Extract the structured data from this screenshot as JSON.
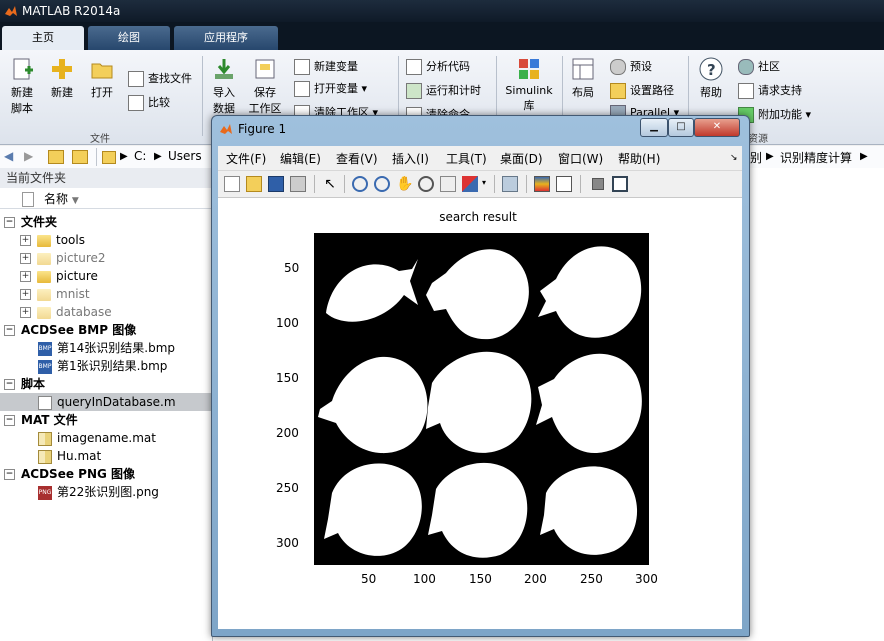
{
  "app": {
    "title": "MATLAB R2014a"
  },
  "ribbon_tabs": [
    {
      "label": "主页",
      "active": true
    },
    {
      "label": "绘图",
      "active": false
    },
    {
      "label": "应用程序",
      "active": false
    }
  ],
  "ribbon": {
    "new_script": "新建\n脚本",
    "new": "新建",
    "open": "打开",
    "find_files": "查找文件",
    "compare": "比较",
    "group_file": "文件",
    "import_data": "导入\n数据",
    "save_workspace": "保存\n工作区",
    "new_variable": "新建变量",
    "open_variable": "打开变量",
    "clear_workspace": "清除工作区",
    "analyze_code": "分析代码",
    "run_and_time": "运行和计时",
    "clear_commands": "清除命令",
    "simulink": "Simulink\n库",
    "layout": "布局",
    "preferences": "预设",
    "set_path": "设置路径",
    "parallel": "Parallel",
    "help": "帮助",
    "community": "社区",
    "request_support": "请求支持",
    "add_ons": "附加功能",
    "group_resources": "资源"
  },
  "address": {
    "drive": "C:",
    "users": "Users",
    "tail_1": "别",
    "tail_2": "识别精度计算"
  },
  "file_panel": {
    "title": "当前文件夹",
    "column_name": "名称",
    "groups": [
      {
        "label": "文件夹",
        "items": [
          {
            "name": "tools",
            "dim": false
          },
          {
            "name": "picture2",
            "dim": true
          },
          {
            "name": "picture",
            "dim": false
          },
          {
            "name": "mnist",
            "dim": true
          },
          {
            "name": "database",
            "dim": true
          }
        ]
      },
      {
        "label": "ACDSee BMP 图像",
        "items": [
          {
            "name": "第14张识别结果.bmp"
          },
          {
            "name": "第1张识别结果.bmp"
          }
        ]
      },
      {
        "label": "脚本",
        "items": [
          {
            "name": "queryInDatabase.m",
            "selected": true
          }
        ]
      },
      {
        "label": "MAT 文件",
        "items": [
          {
            "name": "imagename.mat"
          },
          {
            "name": "Hu.mat"
          }
        ]
      },
      {
        "label": "ACDSee PNG 图像",
        "items": [
          {
            "name": "第22张识别图.png"
          }
        ]
      }
    ]
  },
  "figure": {
    "title": "Figure 1",
    "menu": [
      "文件(F)",
      "编辑(E)",
      "查看(V)",
      "插入(I)",
      "工具(T)",
      "桌面(D)",
      "窗口(W)",
      "帮助(H)"
    ],
    "plot_title": "search result",
    "x_ticks": [
      "50",
      "100",
      "150",
      "200",
      "250",
      "300"
    ],
    "y_ticks": [
      "50",
      "100",
      "150",
      "200",
      "250",
      "300"
    ]
  }
}
